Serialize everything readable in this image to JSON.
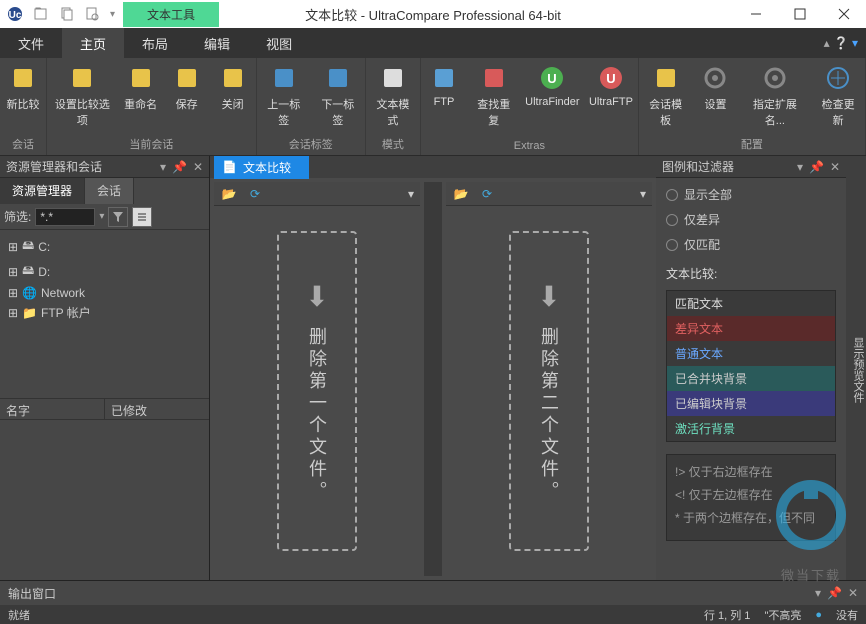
{
  "title": "文本比较 - UltraCompare Professional 64-bit",
  "titlebar_tab": "文本工具",
  "menu": {
    "items": [
      "文件",
      "主页",
      "布局",
      "编辑",
      "视图"
    ],
    "active": 1
  },
  "ribbon": {
    "groups": [
      {
        "label": "会话",
        "items": [
          {
            "label": "新比较",
            "icon": "new-compare"
          }
        ]
      },
      {
        "label": "当前会话",
        "items": [
          {
            "label": "设置比较选项",
            "icon": "options"
          },
          {
            "label": "重命名",
            "icon": "rename"
          },
          {
            "label": "保存",
            "icon": "save"
          },
          {
            "label": "关闭",
            "icon": "close"
          }
        ]
      },
      {
        "label": "会话标签",
        "items": [
          {
            "label": "上一标签",
            "icon": "prev-tab"
          },
          {
            "label": "下一标签",
            "icon": "next-tab"
          }
        ]
      },
      {
        "label": "模式",
        "items": [
          {
            "label": "文本模式",
            "icon": "text-mode"
          }
        ]
      },
      {
        "label": "Extras",
        "items": [
          {
            "label": "FTP",
            "icon": "ftp"
          },
          {
            "label": "查找重复",
            "icon": "find-dup"
          },
          {
            "label": "UltraFinder",
            "icon": "ufinder"
          },
          {
            "label": "UltraFTP",
            "icon": "uftp"
          }
        ]
      },
      {
        "label": "配置",
        "items": [
          {
            "label": "会话模板",
            "icon": "template"
          },
          {
            "label": "设置",
            "icon": "settings"
          },
          {
            "label": "指定扩展名...",
            "icon": "extensions"
          },
          {
            "label": "检查更新",
            "icon": "update"
          }
        ]
      }
    ]
  },
  "left": {
    "header": "资源管理器和会话",
    "tabs": [
      "资源管理器",
      "会话"
    ],
    "active_tab": 0,
    "filter_label": "筛选:",
    "filter_value": "*.*",
    "tree": [
      {
        "label": "C:",
        "icon": "drive"
      },
      {
        "label": "D:",
        "icon": "drive"
      },
      {
        "label": "Network",
        "icon": "network"
      },
      {
        "label": "FTP 帐户",
        "icon": "ftp-account"
      }
    ],
    "cols": [
      "名字",
      "已修改"
    ]
  },
  "center": {
    "tab": "文本比较",
    "drop1": "删除第一个文件。",
    "drop2": "删除第二个文件。"
  },
  "right": {
    "header": "图例和过滤器",
    "side_strip": "显示预览文件",
    "radios": [
      "显示全部",
      "仅差异",
      "仅匹配"
    ],
    "section": "文本比较:",
    "legend": [
      {
        "label": "匹配文本",
        "cls": "leg-match"
      },
      {
        "label": "差异文本",
        "cls": "leg-diff"
      },
      {
        "label": "普通文本",
        "cls": "leg-normal"
      },
      {
        "label": "已合并块背景",
        "cls": "leg-merged"
      },
      {
        "label": "已编辑块背景",
        "cls": "leg-edited"
      },
      {
        "label": "激活行背景",
        "cls": "leg-active"
      }
    ],
    "hints": [
      "!> 仅于右边框存在",
      "<! 仅于左边框存在",
      "* 于两个边框存在，但不同"
    ]
  },
  "output": {
    "label": "输出窗口"
  },
  "status": {
    "left": "就绪",
    "pos": "行 1, 列 1",
    "highlight": "\"不高亮",
    "other": "没有"
  },
  "watermark": "微当下载"
}
